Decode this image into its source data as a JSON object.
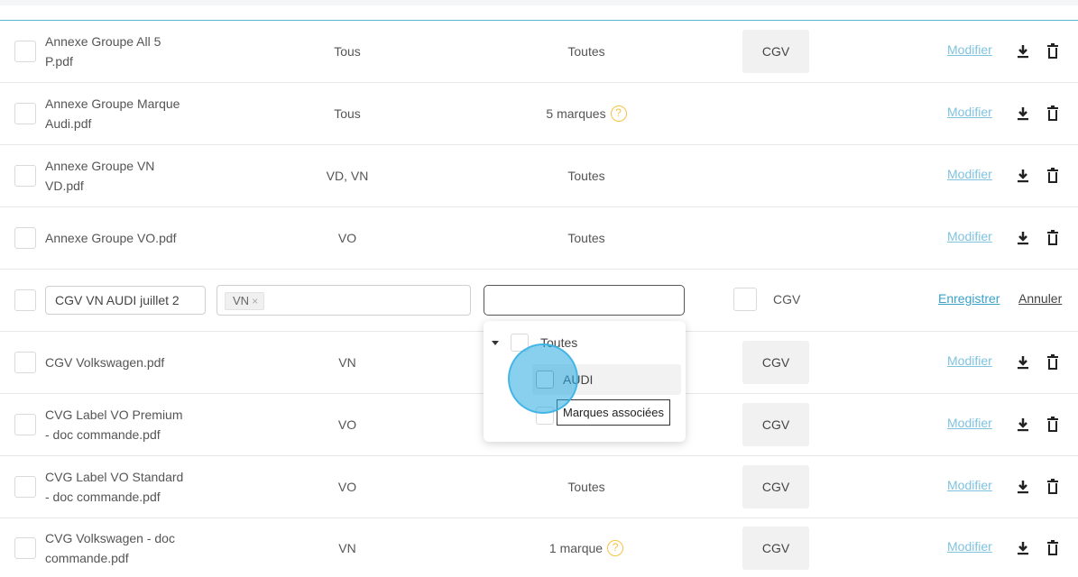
{
  "rows": [
    {
      "name_line1": "Annexe Groupe All 5",
      "name_line2": "P.pdf",
      "type": "Tous",
      "brands": "Toutes",
      "has_help": false,
      "cgv": "CGV",
      "action": "Modifier"
    },
    {
      "name_line1": "Annexe Groupe Marque",
      "name_line2": "Audi.pdf",
      "type": "Tous",
      "brands": "5 marques",
      "has_help": true,
      "cgv": "",
      "action": "Modifier"
    },
    {
      "name_line1": "Annexe Groupe VN",
      "name_line2": "VD.pdf",
      "type": "VD, VN",
      "brands": "Toutes",
      "has_help": false,
      "cgv": "",
      "action": "Modifier"
    },
    {
      "name_line1": "Annexe Groupe VO.pdf",
      "name_line2": "",
      "type": "VO",
      "brands": "Toutes",
      "has_help": false,
      "cgv": "",
      "action": "Modifier"
    }
  ],
  "edit_row": {
    "name_value": "CGV VN AUDI juillet 2",
    "type_tag": "VN",
    "type_tag_remove": "×",
    "brand_value": "",
    "cgv_label": "CGV",
    "save_label": "Enregistrer",
    "cancel_label": "Annuler"
  },
  "rows_after": [
    {
      "name_line1": "CGV Volkswagen.pdf",
      "name_line2": "",
      "type": "VN",
      "brands": "",
      "has_help": false,
      "cgv": "CGV",
      "action": "Modifier"
    },
    {
      "name_line1": "CVG Label VO Premium",
      "name_line2": "- doc commande.pdf",
      "type": "VO",
      "brands": "",
      "has_help": false,
      "cgv": "CGV",
      "action": "Modifier"
    },
    {
      "name_line1": "CVG Label VO Standard",
      "name_line2": "- doc commande.pdf",
      "type": "VO",
      "brands": "Toutes",
      "has_help": false,
      "cgv": "CGV",
      "action": "Modifier"
    },
    {
      "name_line1": "CVG Volkswagen - doc",
      "name_line2": "commande.pdf",
      "type": "VN",
      "brands": "1 marque",
      "has_help": true,
      "cgv": "CGV",
      "action": "Modifier"
    }
  ],
  "dropdown": {
    "root_label": "Toutes",
    "items": [
      "AUDI"
    ]
  },
  "tooltip": "Marques associées",
  "help_glyph": "?",
  "icons": {
    "download": "download-icon",
    "delete": "trash-icon",
    "expand": "caret-down-icon"
  },
  "colors": {
    "link": "#7fc3df",
    "save_link": "#3aa1c8",
    "help": "#f6c343",
    "cursor": "#28aae1"
  }
}
